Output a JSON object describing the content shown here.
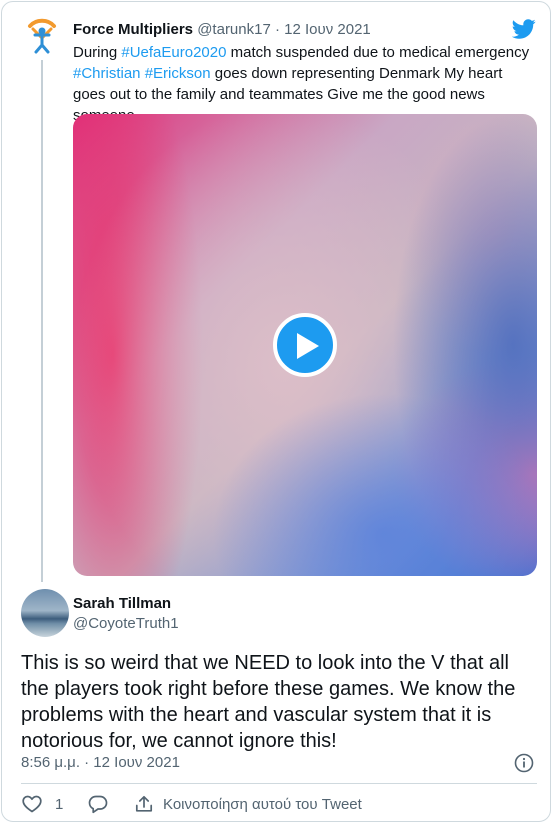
{
  "parent": {
    "name": "Force Multipliers",
    "handle": "@tarunk17",
    "separator": "·",
    "date": "12 Ιουν 2021",
    "text_prefix": "During ",
    "hashtag_1": "#UefaEuro2020",
    "text_mid_1": " match suspended due to medical emergency ",
    "hashtag_2": "#Christian",
    "text_space": " ",
    "hashtag_3": "#Erickson",
    "text_suffix": " goes down representing Denmark My heart goes out to the family and teammates Give me the good news someone"
  },
  "reply": {
    "name": "Sarah Tillman",
    "handle": "@CoyoteTruth1",
    "text": "This is so weird that we NEED to look into the V that all the players took right before these games.  We know the problems with the heart and vascular system that it is notorious for, we cannot ignore this!",
    "timestamp": "8:56 μ.μ. · 12 Ιουν 2021"
  },
  "actions": {
    "like_count": "1",
    "share_label": "Κοινοποίηση αυτού του Tweet"
  },
  "icons": {
    "brand": "twitter-bird-icon",
    "play": "play-icon",
    "info": "info-icon",
    "like": "heart-icon",
    "reply": "reply-icon",
    "share": "share-icon"
  },
  "colors": {
    "accent": "#1d9bf0",
    "text": "#0f1419",
    "muted": "#536471",
    "border": "#cfd9de"
  }
}
